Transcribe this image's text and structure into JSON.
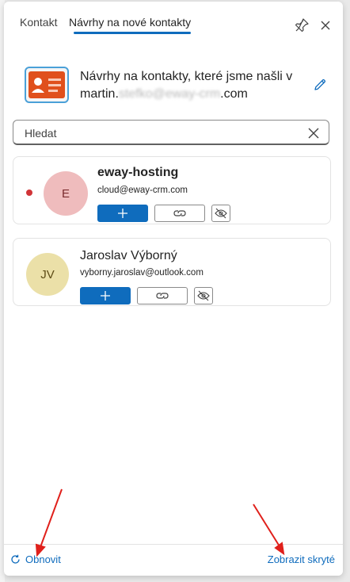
{
  "tabs": {
    "contact": "Kontakt",
    "suggestions": "Návrhy na nové kontakty"
  },
  "intro": {
    "line1": "Návrhy na kontakty, které jsme našli v",
    "email_prefix": "martin.",
    "email_blurred": "stefko@eway-crm",
    "email_suffix": ".com"
  },
  "search": {
    "placeholder": "Hledat"
  },
  "contacts": [
    {
      "initials": "E",
      "name": "eway-hosting",
      "email": "cloud@eway-crm.com",
      "unread": true
    },
    {
      "initials": "JV",
      "name": "Jaroslav Výborný",
      "email": "vyborny.jaroslav@outlook.com",
      "unread": false
    }
  ],
  "footer": {
    "refresh": "Obnovit",
    "show_hidden": "Zobrazit skryté"
  },
  "colors": {
    "accent": "#0f6cbd",
    "annotation": "#e0201b",
    "unread_dot": "#d13438"
  },
  "icons": [
    "pin-icon",
    "close-icon",
    "contact-card-icon",
    "edit-icon",
    "clear-icon",
    "add-icon",
    "link-icon",
    "hide-icon",
    "refresh-icon"
  ]
}
